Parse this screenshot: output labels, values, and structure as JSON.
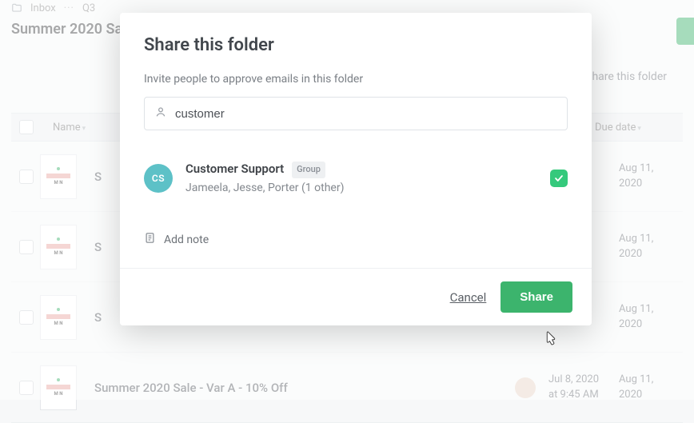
{
  "breadcrumb": {
    "inbox": "Inbox",
    "dots": "···",
    "current": "Q3"
  },
  "page": {
    "title": "Summer 2020 Sal",
    "share_link": "hare this folder"
  },
  "table": {
    "headers": {
      "name": "Name",
      "due": "Due date"
    }
  },
  "rows": [
    {
      "name": "S",
      "date_line1": "",
      "date_line2": "",
      "due_line1": "Aug 11,",
      "due_line2": "2020"
    },
    {
      "name": "S",
      "date_line1": "",
      "date_line2": "",
      "due_line1": "Aug 11,",
      "due_line2": "2020"
    },
    {
      "name": "S",
      "date_line1": "",
      "date_line2": "",
      "due_line1": "Aug 11,",
      "due_line2": "2020"
    },
    {
      "name": "Summer 2020 Sale - Var A - 10% Off",
      "date_line1": "Jul 8, 2020",
      "date_line2": "at 9:45 AM",
      "due_line1": "Aug 11,",
      "due_line2": "2020"
    }
  ],
  "modal": {
    "title": "Share this folder",
    "subtitle": "Invite people to approve emails in this folder",
    "search_value": "customer",
    "result": {
      "initials": "CS",
      "name": "Customer Support",
      "badge": "Group",
      "members": "Jameela, Jesse, Porter (1 other)"
    },
    "add_note": "Add note",
    "cancel": "Cancel",
    "share": "Share"
  }
}
